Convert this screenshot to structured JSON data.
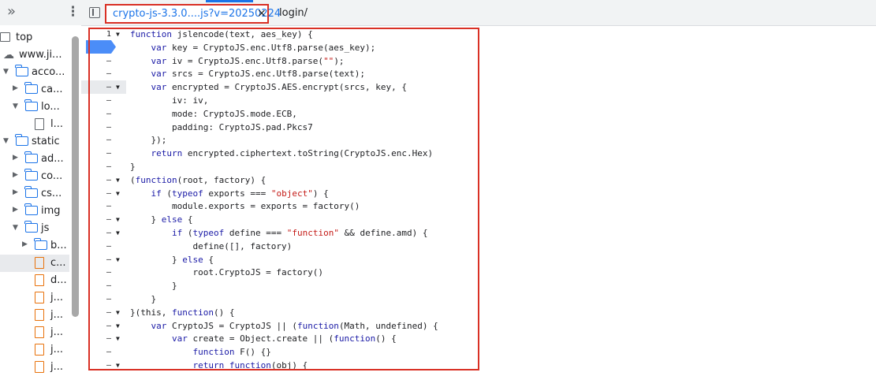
{
  "navigator": {
    "more_tabs_icon": "double-chevron-right-icon",
    "menu_icon": "kebab-menu-icon",
    "items": [
      {
        "label": "top",
        "icon": "frame-icon"
      },
      {
        "label": "www.ji...",
        "icon": "cloud-icon"
      },
      {
        "label": "acco...",
        "icon": "folder-icon"
      },
      {
        "label": "ca...",
        "icon": "folder-icon"
      },
      {
        "label": "lo...",
        "icon": "folder-icon"
      },
      {
        "label": "l...",
        "icon": "file-icon"
      },
      {
        "label": "static",
        "icon": "folder-icon"
      },
      {
        "label": "ad...",
        "icon": "folder-icon"
      },
      {
        "label": "co...",
        "icon": "folder-icon"
      },
      {
        "label": "cs...",
        "icon": "folder-icon"
      },
      {
        "label": "img",
        "icon": "folder-icon"
      },
      {
        "label": "js",
        "icon": "folder-icon"
      },
      {
        "label": "b...",
        "icon": "folder-icon"
      },
      {
        "label": "c...",
        "icon": "js-file-icon"
      },
      {
        "label": "d...",
        "icon": "js-file-icon"
      },
      {
        "label": "j...",
        "icon": "js-file-icon"
      },
      {
        "label": "j...",
        "icon": "js-file-icon"
      },
      {
        "label": "j...",
        "icon": "js-file-icon"
      },
      {
        "label": "j...",
        "icon": "js-file-icon"
      },
      {
        "label": "j...",
        "icon": "js-file-icon"
      }
    ]
  },
  "tabs": {
    "toggle_icon": "sidebar-toggle-icon",
    "active": {
      "label": "crypto-js-3.3.0....js?v=20250224",
      "close": "×"
    },
    "other": {
      "label": "login/"
    }
  },
  "editor": {
    "first_line_number": "1",
    "breakpoint_line": 2,
    "lines": [
      "function jslencode(text, aes_key) {",
      "    var key = CryptoJS.enc.Utf8.parse(aes_key);",
      "    var iv = CryptoJS.enc.Utf8.parse(\"\");",
      "    var srcs = CryptoJS.enc.Utf8.parse(text);",
      "    var encrypted = CryptoJS.AES.encrypt(srcs, key, {",
      "        iv: iv,",
      "        mode: CryptoJS.mode.ECB,",
      "        padding: CryptoJS.pad.Pkcs7",
      "    });",
      "    return encrypted.ciphertext.toString(CryptoJS.enc.Hex)",
      "}",
      "(function(root, factory) {",
      "    if (typeof exports === \"object\") {",
      "        module.exports = exports = factory()",
      "    } else {",
      "        if (typeof define === \"function\" && define.amd) {",
      "            define([], factory)",
      "        } else {",
      "            root.CryptoJS = factory()",
      "        }",
      "    }",
      "}(this, function() {",
      "    var CryptoJS = CryptoJS || (function(Math, undefined) {",
      "        var create = Object.create || (function() {",
      "            function F() {}",
      "            return function(obj) {"
    ],
    "line_markers": [
      "1",
      "",
      "–",
      "–",
      "–",
      "–",
      "–",
      "–",
      "–",
      "–",
      "–",
      "–",
      "–",
      "–",
      "–",
      "–",
      "–",
      "–",
      "–",
      "–",
      "–",
      "–",
      "–",
      "–",
      "–",
      "–"
    ]
  }
}
